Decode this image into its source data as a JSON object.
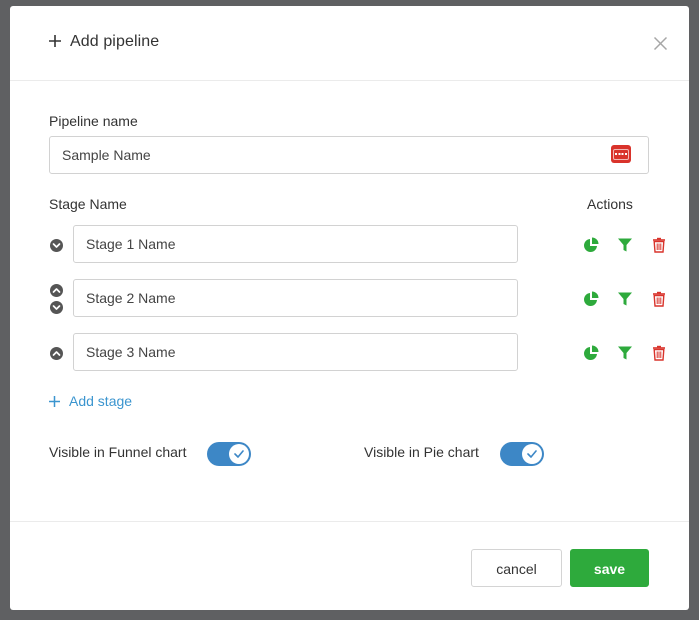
{
  "dialog": {
    "title": "Add pipeline"
  },
  "pipeline": {
    "label": "Pipeline name",
    "value": "Sample Name"
  },
  "stages": {
    "column_label": "Stage Name",
    "actions_label": "Actions",
    "items": [
      {
        "value": "Stage 1 Name"
      },
      {
        "value": "Stage 2 Name"
      },
      {
        "value": "Stage 3 Name"
      }
    ],
    "add_label": "Add stage"
  },
  "toggles": {
    "funnel": {
      "label": "Visible in Funnel chart",
      "on": true
    },
    "pie": {
      "label": "Visible in Pie chart",
      "on": true
    }
  },
  "footer": {
    "cancel_label": "cancel",
    "save_label": "save"
  },
  "colors": {
    "accent_blue": "#3d87c6",
    "link_blue": "#3b95cf",
    "action_green": "#2eaa3c",
    "delete_red": "#d9332b"
  },
  "icons": {
    "chart": "pie-chart-icon",
    "filter": "filter-icon",
    "delete": "trash-icon"
  }
}
